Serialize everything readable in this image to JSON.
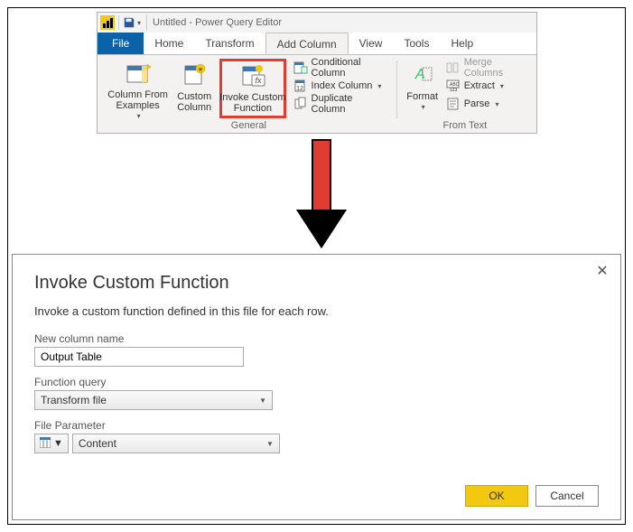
{
  "title_bar": {
    "title_text": "Untitled - Power Query Editor"
  },
  "tabs": {
    "file": "File",
    "home": "Home",
    "transform": "Transform",
    "add_column": "Add Column",
    "view": "View",
    "tools": "Tools",
    "help": "Help"
  },
  "ribbon": {
    "general_group": {
      "label": "General",
      "column_from_examples": "Column From\nExamples",
      "custom_column": "Custom\nColumn",
      "invoke_custom_function": "Invoke Custom\nFunction",
      "conditional_column": "Conditional Column",
      "index_column": "Index Column",
      "duplicate_column": "Duplicate Column"
    },
    "from_text_group": {
      "label": "From Text",
      "format": "Format",
      "merge_columns": "Merge Columns",
      "extract": "Extract",
      "parse": "Parse"
    }
  },
  "dialog": {
    "title": "Invoke Custom Function",
    "subtitle": "Invoke a custom function defined in this file for each row.",
    "new_column_label": "New column name",
    "new_column_value": "Output Table",
    "function_query_label": "Function query",
    "function_query_value": "Transform file",
    "file_param_label": "File Parameter",
    "file_param_value": "Content",
    "ok": "OK",
    "cancel": "Cancel"
  }
}
